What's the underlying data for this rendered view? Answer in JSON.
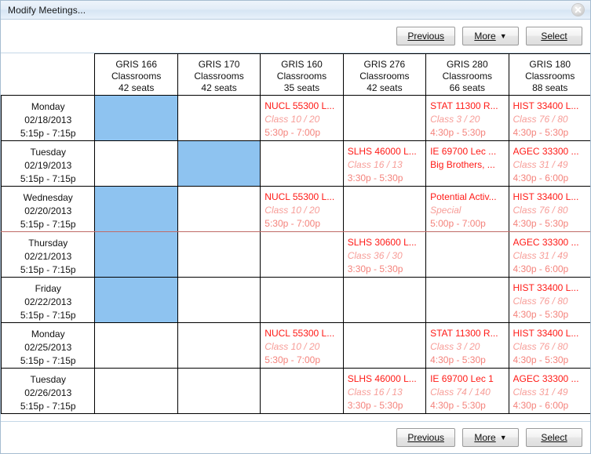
{
  "window": {
    "title": "Modify Meetings...",
    "close_icon": "close-circle-icon"
  },
  "toolbar": {
    "previous_label": "Previous",
    "more_label": "More",
    "more_caret": "▼",
    "select_label": "Select"
  },
  "grid": {
    "corner_label": "",
    "columns": [
      {
        "room": "GRIS 166",
        "type": "Classrooms",
        "seats": "42 seats"
      },
      {
        "room": "GRIS 170",
        "type": "Classrooms",
        "seats": "42 seats"
      },
      {
        "room": "GRIS 160",
        "type": "Classrooms",
        "seats": "35 seats"
      },
      {
        "room": "GRIS 276",
        "type": "Classrooms",
        "seats": "42 seats"
      },
      {
        "room": "GRIS 280",
        "type": "Classrooms",
        "seats": "66 seats"
      },
      {
        "room": "GRIS 180",
        "type": "Classrooms",
        "seats": "88 seats"
      }
    ],
    "rows": [
      {
        "weekday": "Monday",
        "date": "02/18/2013",
        "time": "5:15p - 7:15p",
        "cells": [
          {
            "selected": true
          },
          {},
          {
            "title": "NUCL 55300 L...",
            "sub": "Class 10 / 20",
            "time": "5:30p - 7:00p"
          },
          {},
          {
            "title": "STAT 11300 R...",
            "sub": "Class 3 / 20",
            "time": "4:30p - 5:30p"
          },
          {
            "title": "HIST 33400 L...",
            "sub": "Class 76 / 80",
            "time": "4:30p - 5:30p"
          }
        ]
      },
      {
        "weekday": "Tuesday",
        "date": "02/19/2013",
        "time": "5:15p - 7:15p",
        "cells": [
          {},
          {
            "selected": true
          },
          {},
          {
            "title": "SLHS 46000 L...",
            "sub": "Class 16 / 13",
            "time": "3:30p - 5:30p"
          },
          {
            "title": "IE 69700 Lec ...",
            "sub": "Big Brothers, ...",
            "sub_plain": true
          },
          {
            "title": "AGEC 33300 ...",
            "sub": "Class 31 / 49",
            "time": "4:30p - 6:00p"
          }
        ]
      },
      {
        "weekday": "Wednesday",
        "date": "02/20/2013",
        "time": "5:15p - 7:15p",
        "cells": [
          {
            "selected": true
          },
          {},
          {
            "title": "NUCL 55300 L...",
            "sub": "Class 10 / 20",
            "time": "5:30p - 7:00p"
          },
          {},
          {
            "title": "Potential Activ...",
            "sub": "Special",
            "time": "5:00p - 7:00p"
          },
          {
            "title": "HIST 33400 L...",
            "sub": "Class 76 / 80",
            "time": "4:30p - 5:30p"
          }
        ]
      },
      {
        "weekday": "Thursday",
        "date": "02/21/2013",
        "time": "5:15p - 7:15p",
        "cells": [
          {
            "selected": true
          },
          {},
          {},
          {
            "title": "SLHS 30600 L...",
            "sub": "Class 36 / 30",
            "time": "3:30p - 5:30p"
          },
          {},
          {
            "title": "AGEC 33300 ...",
            "sub": "Class 31 / 49",
            "time": "4:30p - 6:00p"
          }
        ]
      },
      {
        "weekday": "Friday",
        "date": "02/22/2013",
        "time": "5:15p - 7:15p",
        "cells": [
          {
            "selected": true
          },
          {},
          {},
          {},
          {},
          {
            "title": "HIST 33400 L...",
            "sub": "Class 76 / 80",
            "time": "4:30p - 5:30p"
          }
        ]
      },
      {
        "weekday": "Monday",
        "date": "02/25/2013",
        "time": "5:15p - 7:15p",
        "cells": [
          {},
          {},
          {
            "title": "NUCL 55300 L...",
            "sub": "Class 10 / 20",
            "time": "5:30p - 7:00p"
          },
          {},
          {
            "title": "STAT 11300 R...",
            "sub": "Class 3 / 20",
            "time": "4:30p - 5:30p"
          },
          {
            "title": "HIST 33400 L...",
            "sub": "Class 76 / 80",
            "time": "4:30p - 5:30p"
          }
        ]
      },
      {
        "weekday": "Tuesday",
        "date": "02/26/2013",
        "time": "5:15p - 7:15p",
        "cells": [
          {},
          {},
          {},
          {
            "title": "SLHS 46000 L...",
            "sub": "Class 16 / 13",
            "time": "3:30p - 5:30p"
          },
          {
            "title": "IE 69700 Lec 1",
            "sub": "Class 74 / 140",
            "time": "4:30p - 5:30p"
          },
          {
            "title": "AGEC 33300 ...",
            "sub": "Class 31 / 49",
            "time": "4:30p - 6:00p"
          }
        ]
      }
    ]
  },
  "colors": {
    "selection_blue": "#8ec3f0",
    "event_title_red": "#ff1a16",
    "event_sub_red": "#f79d98",
    "event_time_red": "#f4837c"
  }
}
